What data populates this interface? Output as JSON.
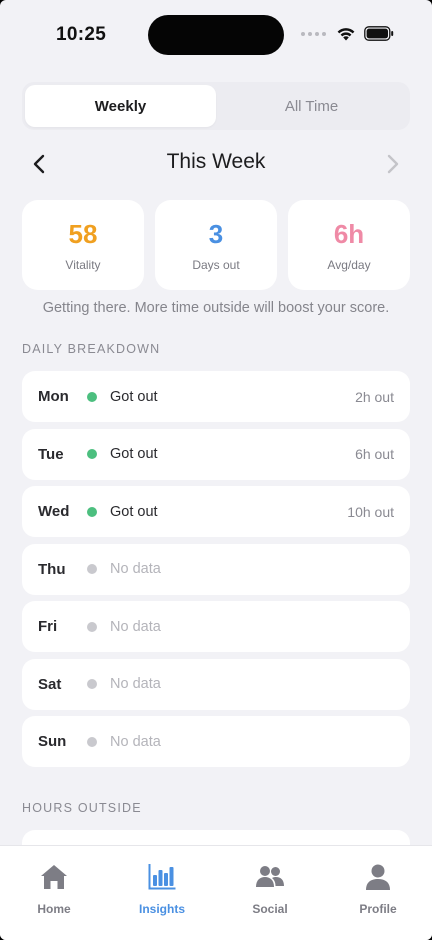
{
  "status_bar": {
    "time": "10:25"
  },
  "segment": {
    "tabs": [
      {
        "label": "Weekly",
        "active": true
      },
      {
        "label": "All Time",
        "active": false
      }
    ]
  },
  "week_nav": {
    "title": "This Week"
  },
  "stats": [
    {
      "value": "58",
      "label": "Vitality",
      "color": "#f0a020"
    },
    {
      "value": "3",
      "label": "Days out",
      "color": "#4a90e2"
    },
    {
      "value": "6h",
      "label": "Avg/day",
      "color": "#ef8aa6"
    }
  ],
  "hint": "Getting there. More time outside will boost your score.",
  "sections": {
    "daily_breakdown": "DAILY BREAKDOWN",
    "hours_outside": "HOURS OUTSIDE"
  },
  "days": [
    {
      "day": "Mon",
      "status": "Got out",
      "hours": "2h out",
      "has_data": true
    },
    {
      "day": "Tue",
      "status": "Got out",
      "hours": "6h out",
      "has_data": true
    },
    {
      "day": "Wed",
      "status": "Got out",
      "hours": "10h out",
      "has_data": true
    },
    {
      "day": "Thu",
      "status": "No data",
      "hours": "",
      "has_data": false
    },
    {
      "day": "Fri",
      "status": "No data",
      "hours": "",
      "has_data": false
    },
    {
      "day": "Sat",
      "status": "No data",
      "hours": "",
      "has_data": false
    },
    {
      "day": "Sun",
      "status": "No data",
      "hours": "",
      "has_data": false
    }
  ],
  "colors": {
    "got_out_dot": "#4cbf7f",
    "no_data_dot": "#c9c9ce",
    "got_out_text": "#2a2a2e",
    "no_data_text": "#b4b4ba",
    "accent": "#4a90e2"
  },
  "tabbar": {
    "tabs": [
      {
        "label": "Home",
        "icon": "home-icon",
        "active": false
      },
      {
        "label": "Insights",
        "icon": "bar-chart-icon",
        "active": true
      },
      {
        "label": "Social",
        "icon": "people-icon",
        "active": false
      },
      {
        "label": "Profile",
        "icon": "person-icon",
        "active": false
      }
    ]
  }
}
